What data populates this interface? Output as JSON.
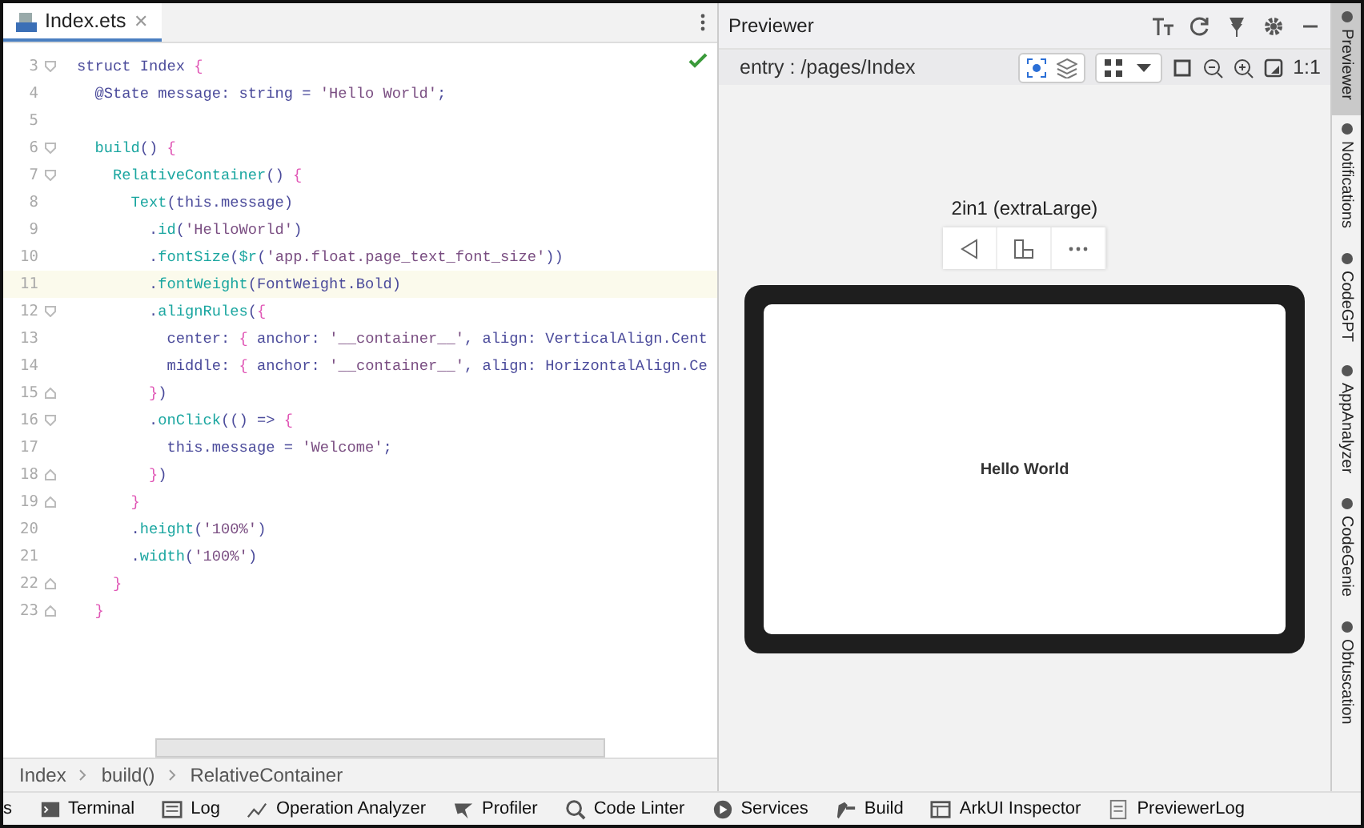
{
  "editor": {
    "tab": {
      "label": "Index.ets",
      "close_label": "✕",
      "selected": true
    },
    "lines": [
      {
        "number": "3",
        "kind": "fold-start",
        "highlighted": false,
        "code": "struct Index {"
      },
      {
        "number": "4",
        "kind": "plain",
        "highlighted": false,
        "code": "  @State message: string = 'Hello World';"
      },
      {
        "number": "5",
        "kind": "plain",
        "highlighted": false
      },
      {
        "number": "6",
        "kind": "fold-start",
        "highlighted": false,
        "code": "  build() {"
      },
      {
        "number": "7",
        "kind": "fold-start",
        "highlighted": false,
        "code": "    RelativeContainer() {"
      },
      {
        "number": "8",
        "kind": "plain",
        "highlighted": false,
        "code": "      Text(this.message)"
      },
      {
        "number": "9",
        "kind": "plain",
        "highlighted": false,
        "code": "        .id('HelloWorld')"
      },
      {
        "number": "10",
        "kind": "plain",
        "highlighted": false,
        "code": "        .fontSize($r('app.float.page_text_font_size'))"
      },
      {
        "number": "11",
        "kind": "plain",
        "highlighted": true,
        "code": "        .fontWeight(FontWeight.Bold)"
      },
      {
        "number": "12",
        "kind": "fold-start",
        "highlighted": false,
        "code": "        .alignRules({"
      },
      {
        "number": "13",
        "kind": "plain",
        "highlighted": false,
        "code": "          center: { anchor: '__container__', align: VerticalAlign.Cent"
      },
      {
        "number": "14",
        "kind": "plain",
        "highlighted": false,
        "code": "          middle: { anchor: '__container__', align: HorizontalAlign.Ce"
      },
      {
        "number": "15",
        "kind": "fold-end",
        "highlighted": false,
        "code": "        })"
      },
      {
        "number": "16",
        "kind": "fold-start",
        "highlighted": false,
        "code": "        .onClick(() => {"
      },
      {
        "number": "17",
        "kind": "plain",
        "highlighted": false,
        "code": "          this.message = 'Welcome';"
      },
      {
        "number": "18",
        "kind": "fold-end",
        "highlighted": false,
        "code": "        })"
      },
      {
        "number": "19",
        "kind": "fold-end",
        "highlighted": false,
        "code": "      }"
      },
      {
        "number": "20",
        "kind": "plain",
        "highlighted": false,
        "code": "      .height('100%')"
      },
      {
        "number": "21",
        "kind": "plain",
        "highlighted": false,
        "code": "      .width('100%')"
      },
      {
        "number": "22",
        "kind": "fold-end",
        "highlighted": false,
        "code": "    }"
      },
      {
        "number": "23",
        "kind": "fold-end",
        "highlighted": false,
        "code": "  }"
      }
    ],
    "breadcrumbs": [
      "Index",
      "build()",
      "RelativeContainer"
    ]
  },
  "previewer": {
    "title": "Previewer",
    "route": "entry : /pages/Index",
    "zoom_label": "1:1",
    "device_label": "2in1 (extraLarge)",
    "screen_text": "Hello World"
  },
  "side_tools": [
    {
      "label": "Previewer",
      "selected": true
    },
    {
      "label": "Notifications",
      "selected": false
    },
    {
      "label": "CodeGPT",
      "selected": false
    },
    {
      "label": "AppAnalyzer",
      "selected": false
    },
    {
      "label": "CodeGenie",
      "selected": false
    },
    {
      "label": "Obfuscation",
      "selected": false
    }
  ],
  "tool_windows": [
    {
      "label": "s",
      "kind": "none"
    },
    {
      "label": "Terminal",
      "kind": "terminal"
    },
    {
      "label": "Log",
      "kind": "log"
    },
    {
      "label": "Operation Analyzer",
      "kind": "chart"
    },
    {
      "label": "Profiler",
      "kind": "profiler"
    },
    {
      "label": "Code Linter",
      "kind": "linter"
    },
    {
      "label": "Services",
      "kind": "services"
    },
    {
      "label": "Build",
      "kind": "build"
    },
    {
      "label": "ArkUI Inspector",
      "kind": "inspector"
    },
    {
      "label": "PreviewerLog",
      "kind": "doc"
    }
  ]
}
